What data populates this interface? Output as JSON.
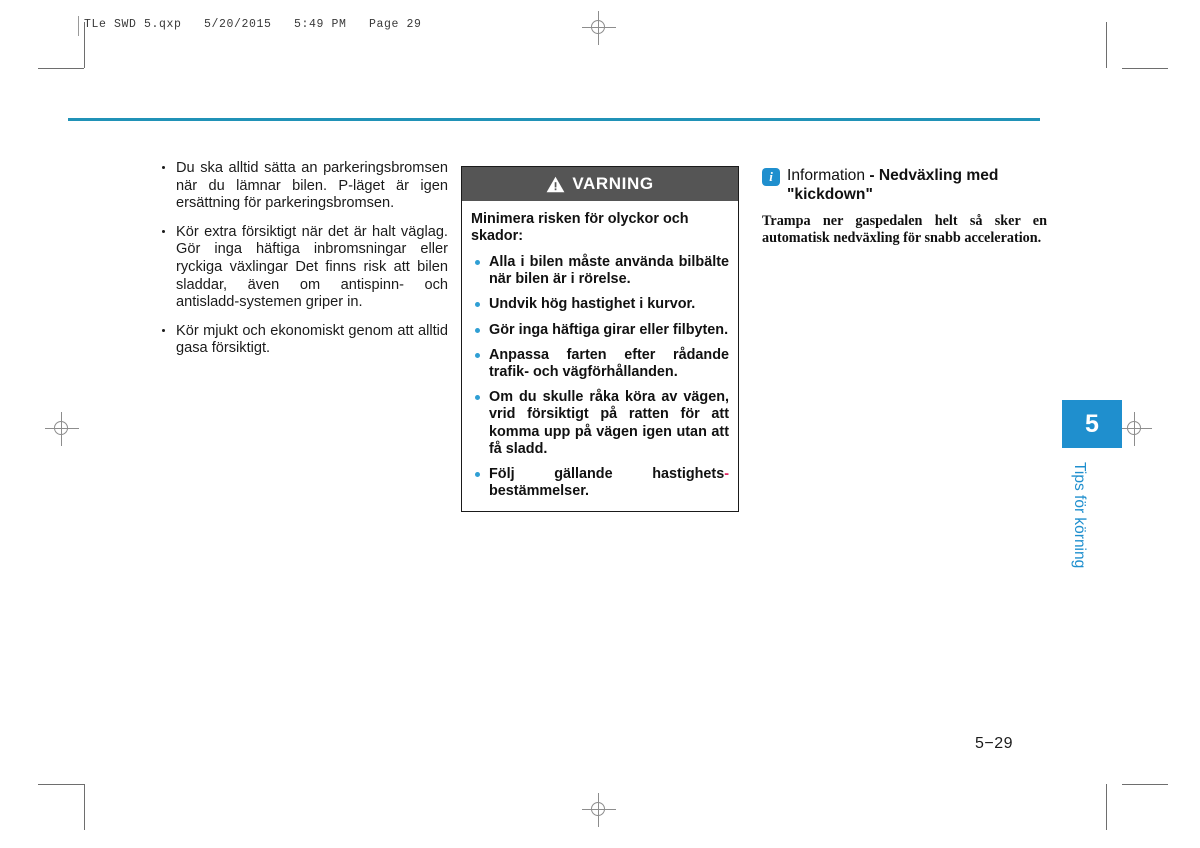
{
  "print_header": "TLe SWD 5.qxp   5/20/2015   5:49 PM   Page 29",
  "colors": {
    "teal_rule": "#2092b7",
    "chapter_blue": "#1f8fce",
    "warning_header_gray": "#555555",
    "warning_bullet_blue": "#2f9fd4",
    "red_hyphen": "#e0245e"
  },
  "left_column": {
    "bullets": [
      "Du ska alltid sätta an parkeringsbromsen när du lämnar bilen. P-läget är igen ersättning för parkeringsbromsen.",
      "Kör extra försiktigt när det är halt väglag. Gör inga häftiga inbromsningar eller ryckiga växlingar Det finns risk att bilen sladdar, även om antispinn- och antisladd-systemen griper in.",
      "Kör mjukt och ekonomiskt genom att alltid gasa försiktigt."
    ]
  },
  "warning_box": {
    "header_label": "VARNING",
    "icon": "warning-triangle-icon",
    "intro": "Minimera risken för olyckor och skador:",
    "bullets": [
      "Alla i bilen måste använda bilbälte när bilen är i rörelse.",
      "Undvik hög hastighet i kurvor.",
      "Gör inga häftiga girar eller filbyten.",
      "Anpassa farten efter rådande trafik- och vägförhållanden.",
      "Om du skulle råka köra av vägen, vrid försiktigt på ratten för att komma upp på vägen igen utan att få sladd."
    ],
    "last_bullet_part1": "Följ gällande hastighets",
    "last_bullet_hyphen": "-",
    "last_bullet_part2": "bestämmelser."
  },
  "information_box": {
    "icon": "info-i-icon",
    "title_regular": "Information",
    "title_bold": " - Nedväxling med \"kickdown\"",
    "body": "Trampa ner gaspedalen helt så sker en automatisk nedväxling för snabb acceleration."
  },
  "chapter_tab": {
    "number": "5",
    "label": "Tips för körning"
  },
  "page_number": "5−29"
}
